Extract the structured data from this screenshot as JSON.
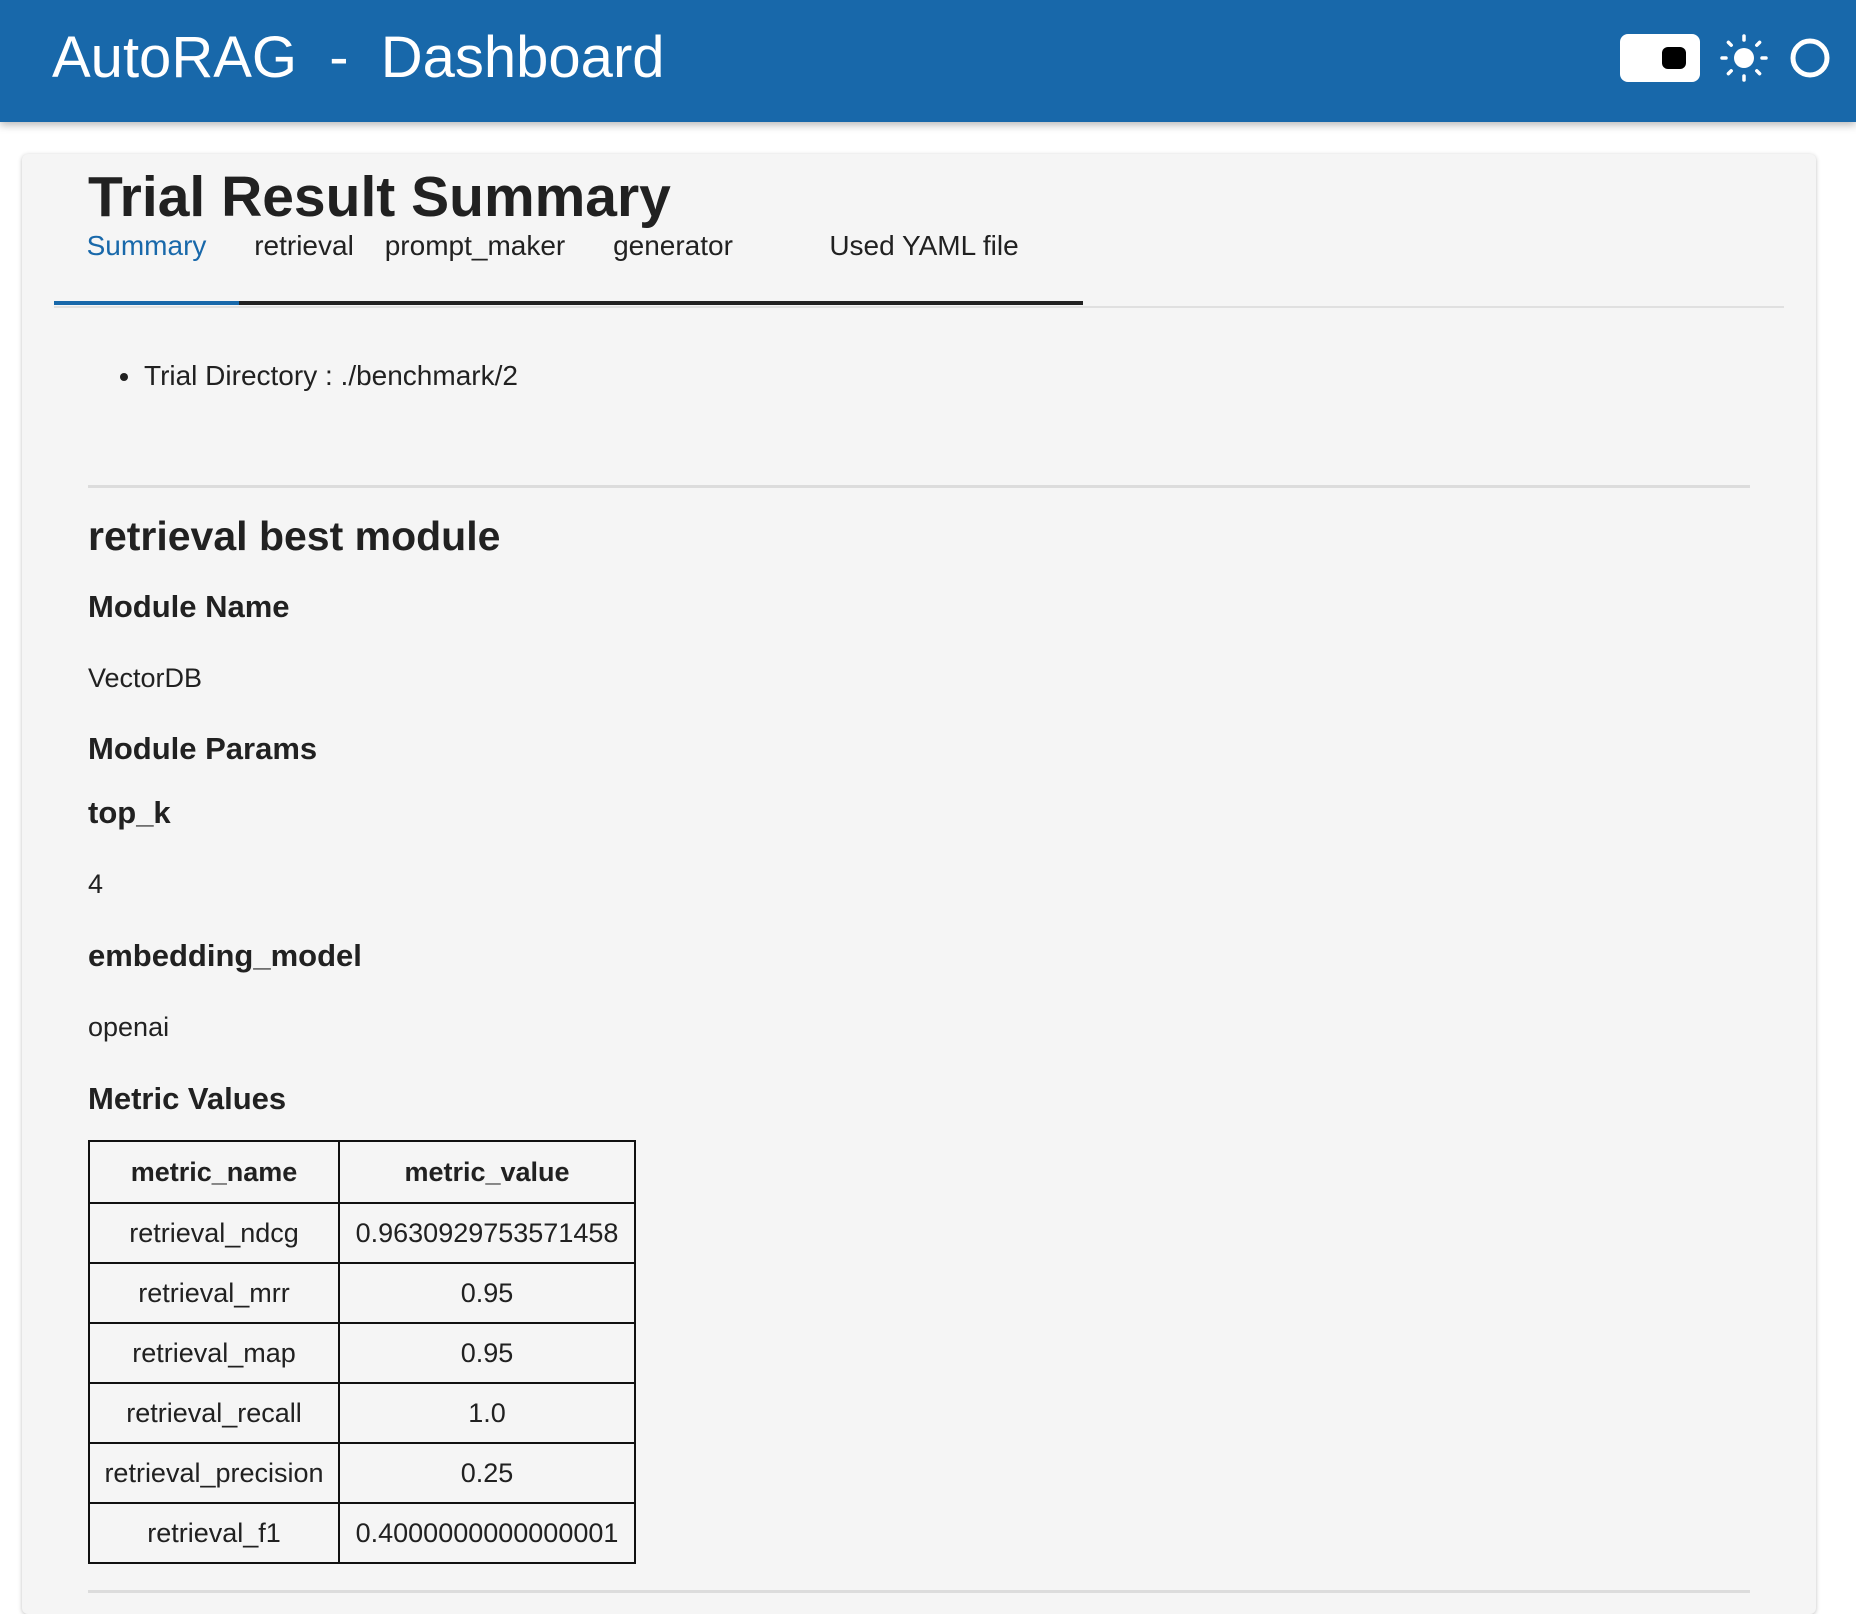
{
  "header": {
    "title": "AutoRAG  -  Dashboard",
    "icons": [
      "dark-mode-toggle",
      "sun-icon",
      "circle-icon"
    ]
  },
  "tabs": [
    {
      "label": "Summary",
      "active": true
    },
    {
      "label": "retrieval",
      "active": false
    },
    {
      "label": "prompt_maker",
      "active": false
    },
    {
      "label": "generator",
      "active": false
    },
    {
      "label": "Used YAML file",
      "active": false
    }
  ],
  "summary": {
    "title": "Trial Result Summary",
    "trial_directory": "Trial Directory : ./benchmark/2",
    "section_title": "retrieval best module",
    "module_name_heading": "Module Name",
    "module_name": "VectorDB",
    "module_params_heading": "Module Params",
    "params": [
      {
        "name": "top_k",
        "value": "4"
      },
      {
        "name": "embedding_model",
        "value": "openai"
      }
    ],
    "metric_values_heading": "Metric Values",
    "metrics_table": {
      "headers": [
        "metric_name",
        "metric_value"
      ],
      "rows": [
        [
          "retrieval_ndcg",
          "0.9630929753571458"
        ],
        [
          "retrieval_mrr",
          "0.95"
        ],
        [
          "retrieval_map",
          "0.95"
        ],
        [
          "retrieval_recall",
          "1.0"
        ],
        [
          "retrieval_precision",
          "0.25"
        ],
        [
          "retrieval_f1",
          "0.4000000000000001"
        ]
      ]
    }
  },
  "colors": {
    "brand": "#1868aa",
    "card_background": "#f5f5f5"
  }
}
